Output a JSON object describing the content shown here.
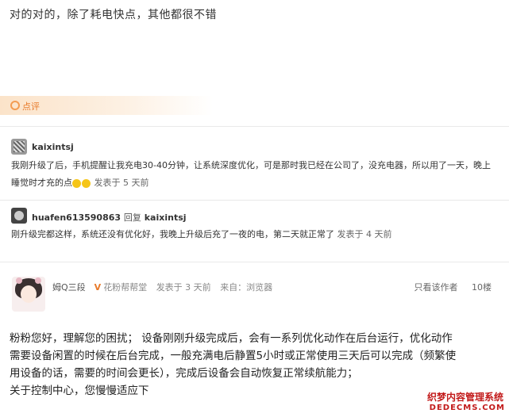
{
  "top_text": "对的对的，除了耗电快点，其他都很不错",
  "section": {
    "label": "点评"
  },
  "comments": [
    {
      "username": "kaixintsj",
      "text_line1": "我刚升级了后，手机提醒让我充电30-40分钟，让系统深度优化，可是那时我已经在公司了，没充电器，所以用了一天，晚上",
      "text_line2": "睡觉时才充的点",
      "meta": "发表于 5 天前"
    },
    {
      "username": "huafen613590863",
      "reply_label": "回复",
      "reply_to": "kaixintsj",
      "text": "刚升级完都这样，系统还没有优化好，我晚上升级后充了一夜的电，第二天就正常了",
      "meta": "发表于 4 天前"
    }
  ],
  "answer": {
    "author": "姆Q三段",
    "badge": "V",
    "group": "花粉帮帮堂",
    "time": "发表于 3 天前",
    "source": "来自：浏览器",
    "view_author_only": "只看该作者",
    "floor": "10楼",
    "lines": [
      "粉粉您好，理解您的困扰； 设备刚刚升级完成后，会有一系列优化动作在后台运行，优化动作",
      "需要设备闲置的时候在后台完成，一般充满电后静置5小时或正常使用三天后可以完成（频繁使",
      "用设备的话，需要的时间会更长），完成后设备会自动恢复正常续航能力；",
      "关于控制中心，您慢慢适应下"
    ]
  },
  "watermark": {
    "cn": "织梦内容管理系统",
    "en": "DEDECMS.COM"
  }
}
